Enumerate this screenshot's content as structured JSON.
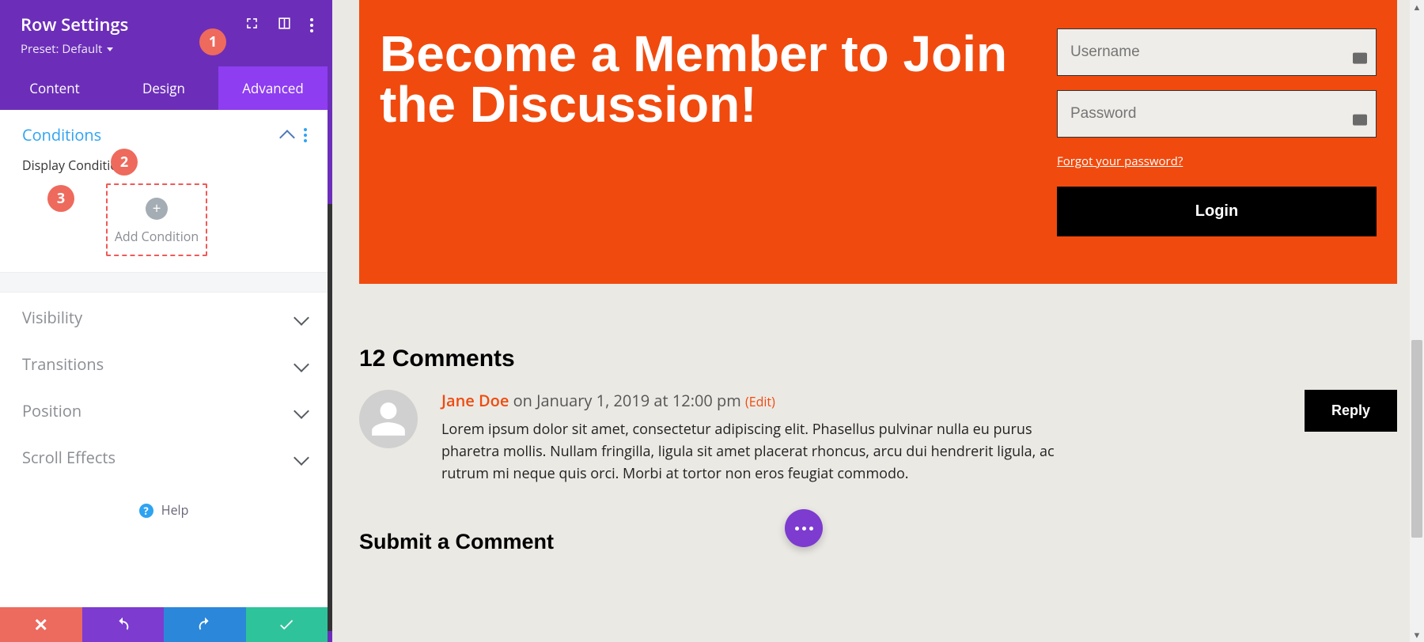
{
  "sidebar": {
    "title": "Row Settings",
    "preset_label": "Preset: Default",
    "tabs": [
      "Content",
      "Design",
      "Advanced"
    ],
    "active_tab_index": 2,
    "conditions": {
      "section_title": "Conditions",
      "display_label": "Display Conditions",
      "add_label": "Add Condition"
    },
    "sections": [
      "Visibility",
      "Transitions",
      "Position",
      "Scroll Effects"
    ],
    "help_label": "Help"
  },
  "annotations": {
    "1": "1",
    "2": "2",
    "3": "3"
  },
  "preview": {
    "cta_title": "Become a Member to Join the Discussion!",
    "login": {
      "username_placeholder": "Username",
      "password_placeholder": "Password",
      "forgot_label": "Forgot your password?",
      "login_label": "Login"
    },
    "comments": {
      "heading": "12 Comments",
      "author": "Jane Doe",
      "meta_rest": " on January 1, 2019 at 12:00 pm ",
      "edit_label": "(Edit)",
      "body": "Lorem ipsum dolor sit amet, consectetur adipiscing elit. Phasellus pulvinar nulla eu purus pharetra mollis. Nullam fringilla, ligula sit amet placerat rhoncus, arcu dui hendrerit ligula, ac rutrum mi neque quis orci. Morbi at tortor non eros feugiat commodo.",
      "reply_label": "Reply",
      "submit_heading": "Submit a Comment"
    }
  }
}
